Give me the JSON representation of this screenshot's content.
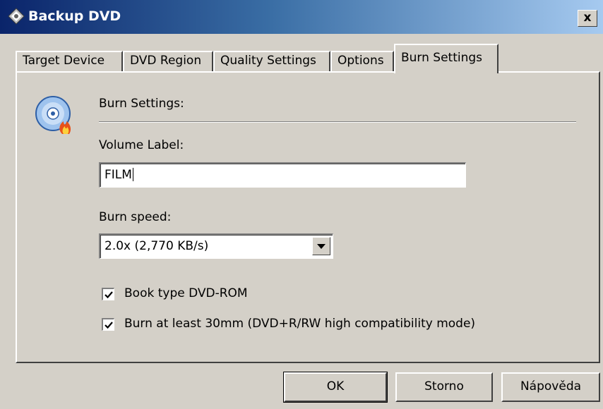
{
  "window": {
    "title": "Backup DVD",
    "close_label": "x"
  },
  "tabs": [
    {
      "label": "Target Device",
      "active": false
    },
    {
      "label": "DVD Region",
      "active": false
    },
    {
      "label": "Quality Settings",
      "active": false
    },
    {
      "label": "Options",
      "active": false
    },
    {
      "label": "Burn Settings",
      "active": true
    }
  ],
  "panel": {
    "section_title": "Burn Settings:",
    "icon": "burning-disc-icon",
    "volume_label": {
      "label": "Volume Label:",
      "value": "FILM"
    },
    "burn_speed": {
      "label": "Burn speed:",
      "selected": "2.0x (2,770 KB/s)"
    },
    "checkboxes": [
      {
        "label": "Book type DVD-ROM",
        "checked": true
      },
      {
        "label": "Burn at least 30mm (DVD+R/RW high compatibility mode)",
        "checked": true
      }
    ]
  },
  "buttons": {
    "ok": "OK",
    "cancel": "Storno",
    "help": "Nápověda"
  },
  "colors": {
    "titlebar_start": "#0a246a",
    "titlebar_end": "#a6caf0",
    "face": "#d4d0c8"
  }
}
